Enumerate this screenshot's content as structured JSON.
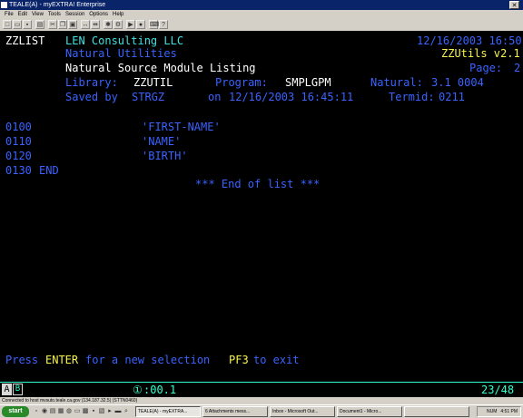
{
  "window": {
    "title": "TEALE(A) - myEXTRA! Enterprise",
    "close_glyph": "✕"
  },
  "menu": [
    "File",
    "Edit",
    "View",
    "Tools",
    "Session",
    "Options",
    "Help"
  ],
  "toolbar_icons": [
    "new-icon",
    "open-icon",
    "save-icon",
    "print-icon",
    "cut-icon",
    "copy-icon",
    "paste-icon",
    "connect-icon",
    "disconnect-icon",
    "hotspot-icon",
    "settings-icon",
    "macro-icon",
    "record-icon",
    "keyboard-icon",
    "help-icon"
  ],
  "screen": {
    "module": "ZZLIST",
    "company": "LEN Consulting LLC",
    "datetime": "12/16/2003 16:50",
    "subtitle": "Natural Utilities",
    "product": "ZZUtils v2.1",
    "title": "Natural Source Module Listing",
    "page_label": "Page:",
    "page_num": "2",
    "library_label": "Library:",
    "library": "ZZUTIL",
    "program_label": "Program:",
    "program": "SMPLGPM",
    "natural_label": "Natural:",
    "natural_version": "3.1 0004",
    "saved_label": "Saved by",
    "saved_by": "STRGZ",
    "saved_on_label": "on",
    "saved_on": "12/16/2003 16:45:11",
    "termid_label": "Termid:",
    "termid": "0211",
    "source_lines": [
      {
        "num": "0100",
        "text": "'FIRST-NAME'"
      },
      {
        "num": "0110",
        "text": "'NAME'"
      },
      {
        "num": "0120",
        "text": "'BIRTH'"
      }
    ],
    "end_line": {
      "num": "0130",
      "text": "END"
    },
    "end_of_list": "*** End of list ***",
    "prompt_press": "Press",
    "prompt_enter": "ENTER",
    "prompt_new": "for a new selection",
    "prompt_pf3": "PF3",
    "prompt_exit": "to exit"
  },
  "oia": {
    "session": "A",
    "lock": "B",
    "timer_symbol": "①",
    "timer": ":00.1",
    "cursor": "23/48"
  },
  "statusbar": {
    "text": "Connected to host mvsuto.teale.ca.gov (134.187.32.5) (STTN0460)"
  },
  "taskbar": {
    "start": "start",
    "tasks": [
      {
        "label": "TEALE(A) - myEXTRA..."
      },
      {
        "label": "6 Attachments mess..."
      },
      {
        "label": "Inbox - Microsoft Out..."
      },
      {
        "label": "Document1 - Micro..."
      },
      {
        "label": ""
      }
    ],
    "tray_mode": "NUM",
    "time": "4:51 PM"
  }
}
